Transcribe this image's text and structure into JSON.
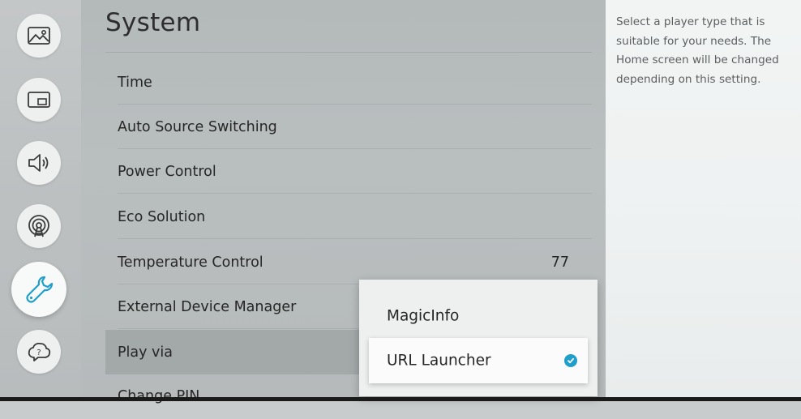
{
  "sidebar": {
    "items": [
      {
        "name": "picture",
        "icon": "picture-icon",
        "active": false
      },
      {
        "name": "screen",
        "icon": "screen-icon",
        "active": false
      },
      {
        "name": "sound",
        "icon": "sound-icon",
        "active": false
      },
      {
        "name": "network",
        "icon": "network-icon",
        "active": false
      },
      {
        "name": "system",
        "icon": "wrench-icon",
        "active": true
      },
      {
        "name": "support",
        "icon": "support-icon",
        "active": false
      }
    ]
  },
  "main": {
    "title": "System",
    "items": [
      {
        "label": "Time",
        "value": ""
      },
      {
        "label": "Auto Source Switching",
        "value": ""
      },
      {
        "label": "Power Control",
        "value": ""
      },
      {
        "label": "Eco Solution",
        "value": ""
      },
      {
        "label": "Temperature Control",
        "value": "77"
      },
      {
        "label": "External Device Manager",
        "value": ""
      },
      {
        "label": "Play via",
        "value": ""
      },
      {
        "label": "Change PIN",
        "value": ""
      }
    ]
  },
  "dropdown": {
    "options": [
      {
        "label": "MagicInfo",
        "selected": false
      },
      {
        "label": "URL Launcher",
        "selected": true
      }
    ],
    "check_color": "#1f9fc9"
  },
  "help": {
    "text": "Select a player type that is suitable for your needs. The Home screen will be changed depending on this setting."
  }
}
